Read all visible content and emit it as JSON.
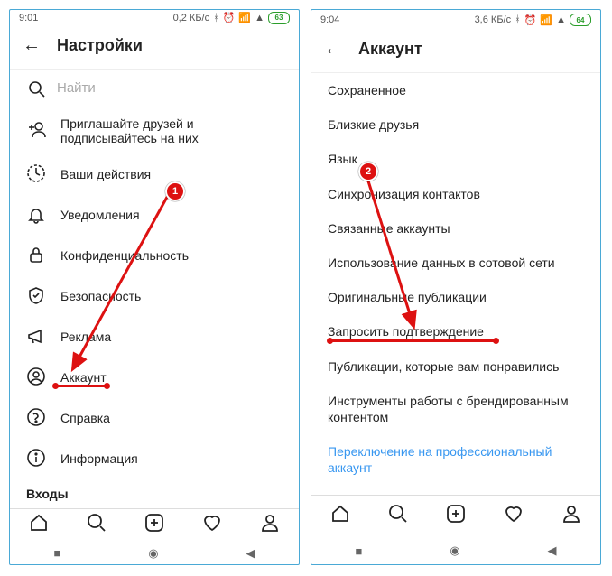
{
  "left": {
    "status": {
      "time": "9:01",
      "net": "0,2 КБ/с",
      "battery": "63"
    },
    "header": {
      "title": "Настройки"
    },
    "search": {
      "placeholder": "Найти"
    },
    "items": [
      {
        "label": "Приглашайте друзей и подписывайтесь на них"
      },
      {
        "label": "Ваши действия"
      },
      {
        "label": "Уведомления"
      },
      {
        "label": "Конфиденциальность"
      },
      {
        "label": "Безопасность"
      },
      {
        "label": "Реклама"
      },
      {
        "label": "Аккаунт"
      },
      {
        "label": "Справка"
      },
      {
        "label": "Информация"
      }
    ],
    "section": "Входы",
    "badge": "1"
  },
  "right": {
    "status": {
      "time": "9:04",
      "net": "3,6 КБ/с",
      "battery": "64"
    },
    "header": {
      "title": "Аккаунт"
    },
    "items": [
      {
        "label": "Сохраненное"
      },
      {
        "label": "Близкие друзья"
      },
      {
        "label": "Язык"
      },
      {
        "label": "Синхронизация контактов"
      },
      {
        "label": "Связанные аккаунты"
      },
      {
        "label": "Использование данных в сотовой сети"
      },
      {
        "label": "Оригинальные публикации"
      },
      {
        "label": "Запросить подтверждение"
      },
      {
        "label": "Публикации, которые вам понравились"
      },
      {
        "label": "Инструменты работы с брендированным контентом"
      }
    ],
    "link": "Переключение на профессиональный аккаунт",
    "badge": "2"
  }
}
